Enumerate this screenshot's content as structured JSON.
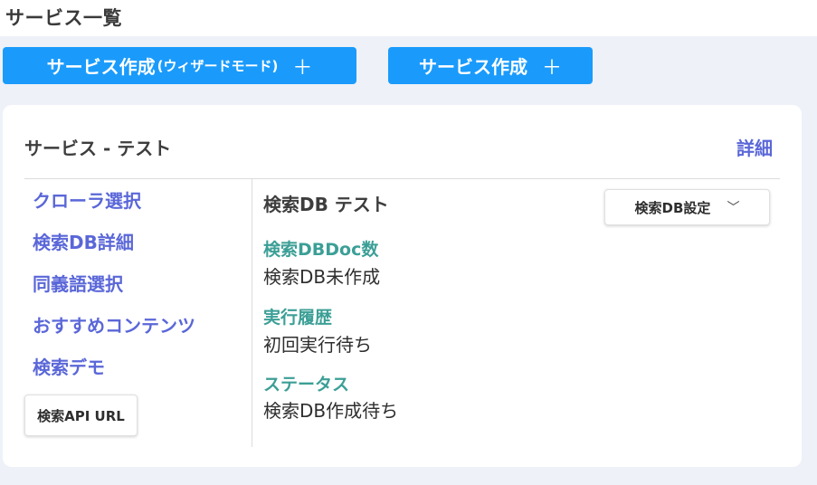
{
  "header": {
    "title": "サービス一覧"
  },
  "actions": {
    "wizard_label_main": "サービス作成",
    "wizard_label_sub": "(ウィザードモード)",
    "create_label": "サービス作成",
    "plus": "＋"
  },
  "service_card": {
    "title": "サービス - テスト",
    "detail_link": "詳細",
    "nav_items": [
      {
        "label": "クローラ選択"
      },
      {
        "label": "検索DB詳細"
      },
      {
        "label": "同義語選択"
      },
      {
        "label": "おすすめコンテンツ"
      },
      {
        "label": "検索デモ"
      }
    ],
    "api_url_button": "検索API URL",
    "db": {
      "title": "検索DB テスト",
      "settings_button": "検索DB設定",
      "settings_chevron": "﹀",
      "fields": [
        {
          "label": "検索DBDoc数",
          "value": "検索DB未作成"
        },
        {
          "label": "実行履歴",
          "value": "初回実行待ち"
        },
        {
          "label": "ステータス",
          "value": "検索DB作成待ち"
        }
      ]
    }
  },
  "colors": {
    "primary": "#1a9bfc",
    "link": "#5a67d8",
    "field_label": "#3b9f96",
    "background": "#eef1f8"
  }
}
